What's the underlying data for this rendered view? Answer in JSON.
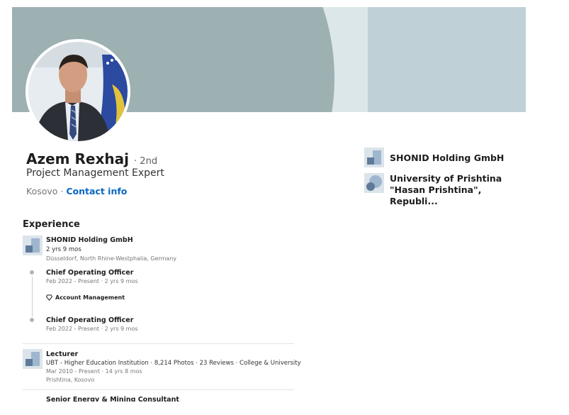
{
  "profile": {
    "name": "Azem Rexhaj",
    "degree": "· 2nd",
    "headline": "Project Management Expert",
    "location": "Kosovo ·",
    "contact_label": "Contact info"
  },
  "orgs": [
    {
      "name": "SHONID Holding GmbH",
      "logo_icon": "company-logo-icon"
    },
    {
      "name_line1": "University of Prishtina",
      "name_line2": "\"Hasan Prishtina\", Republi...",
      "logo_icon": "school-logo-icon"
    }
  ],
  "experience": {
    "title": "Experience",
    "company1": {
      "name": "SHONID Holding GmbH",
      "duration": "2 yrs 9 mos",
      "location": "Düsseldorf, North Rhine-Westphalia, Germany",
      "roles": [
        {
          "title": "Chief Operating Officer",
          "dates": "Feb 2022 - Present · 2 yrs 9 mos",
          "skill": "Account Management"
        },
        {
          "title": "Chief Operating Officer",
          "dates": "Feb 2022 - Present · 2 yrs 9 mos"
        }
      ]
    },
    "job2": {
      "title": "Lecturer",
      "org": "UBT - Higher Education Institution · 8,214 Photos · 23 Reviews · College & University",
      "dates": "Mar 2010 - Present · 14 yrs 8 mos",
      "location": "Prishtina, Kosovo"
    },
    "job3": {
      "title": "Senior Energy & Mining Consultant"
    }
  },
  "colors": {
    "link": "#0a66c2",
    "banner_dark": "#9db0b2",
    "banner_light": "#dce7e9",
    "banner_right": "#bfd1d6"
  }
}
